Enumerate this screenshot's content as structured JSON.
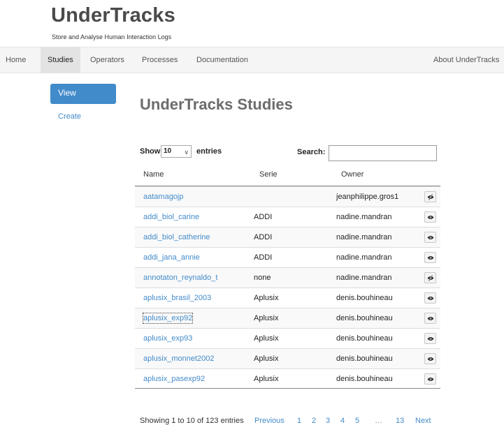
{
  "header": {
    "title": "UnderTracks",
    "subtitle": "Store and Analyse Human Interaction Logs"
  },
  "nav": {
    "items": [
      {
        "label": "Home"
      },
      {
        "label": "Studies",
        "active": true
      },
      {
        "label": "Operators"
      },
      {
        "label": "Processes"
      },
      {
        "label": "Documentation"
      }
    ],
    "right_item": "About UnderTracks"
  },
  "sidebar": {
    "view_label": "View",
    "create_label": "Create"
  },
  "page": {
    "title": "UnderTracks Studies"
  },
  "table_controls": {
    "show_label": "Show",
    "length_value": "10",
    "entries_label": "entries",
    "search_label": "Search:",
    "search_value": ""
  },
  "table": {
    "columns": [
      "Name",
      "Serie",
      "Owner"
    ],
    "rows": [
      {
        "name": "aatamagojp",
        "serie": "",
        "owner": "jeanphilippe.gros1",
        "icon": "eye-slash-icon"
      },
      {
        "name": "addi_biol_carine",
        "serie": "ADDI",
        "owner": "nadine.mandran",
        "icon": "eye-icon"
      },
      {
        "name": "addi_biol_catherine",
        "serie": "ADDI",
        "owner": "nadine.mandran",
        "icon": "eye-icon"
      },
      {
        "name": "addi_jana_annie",
        "serie": "ADDI",
        "owner": "nadine.mandran",
        "icon": "eye-icon"
      },
      {
        "name": "annotaton_reynaldo_t",
        "serie": "none",
        "owner": "nadine.mandran",
        "icon": "eye-slash-icon"
      },
      {
        "name": "aplusix_brasil_2003",
        "serie": "Aplusix",
        "owner": "denis.bouhineau",
        "icon": "eye-icon"
      },
      {
        "name": "aplusix_exp92",
        "serie": "Aplusix",
        "owner": "denis.bouhineau",
        "icon": "eye-icon",
        "focused": true
      },
      {
        "name": "aplusix_exp93",
        "serie": "Aplusix",
        "owner": "denis.bouhineau",
        "icon": "eye-icon"
      },
      {
        "name": "aplusix_monnet2002",
        "serie": "Aplusix",
        "owner": "denis.bouhineau",
        "icon": "eye-icon"
      },
      {
        "name": "aplusix_pasexp92",
        "serie": "Aplusix",
        "owner": "denis.bouhineau",
        "icon": "eye-icon"
      }
    ]
  },
  "footer": {
    "info": "Showing 1 to 10 of 123 entries",
    "pagination": {
      "previous": "Previous",
      "pages": [
        "1",
        "2",
        "3",
        "4",
        "5"
      ],
      "ellipsis": "…",
      "last": "13",
      "next": "Next"
    }
  },
  "colors": {
    "accent": "#428bca",
    "nav_background": "#f5f5f5",
    "nav_active": "#e3e3e3",
    "title_text": "#4a4a4a"
  }
}
